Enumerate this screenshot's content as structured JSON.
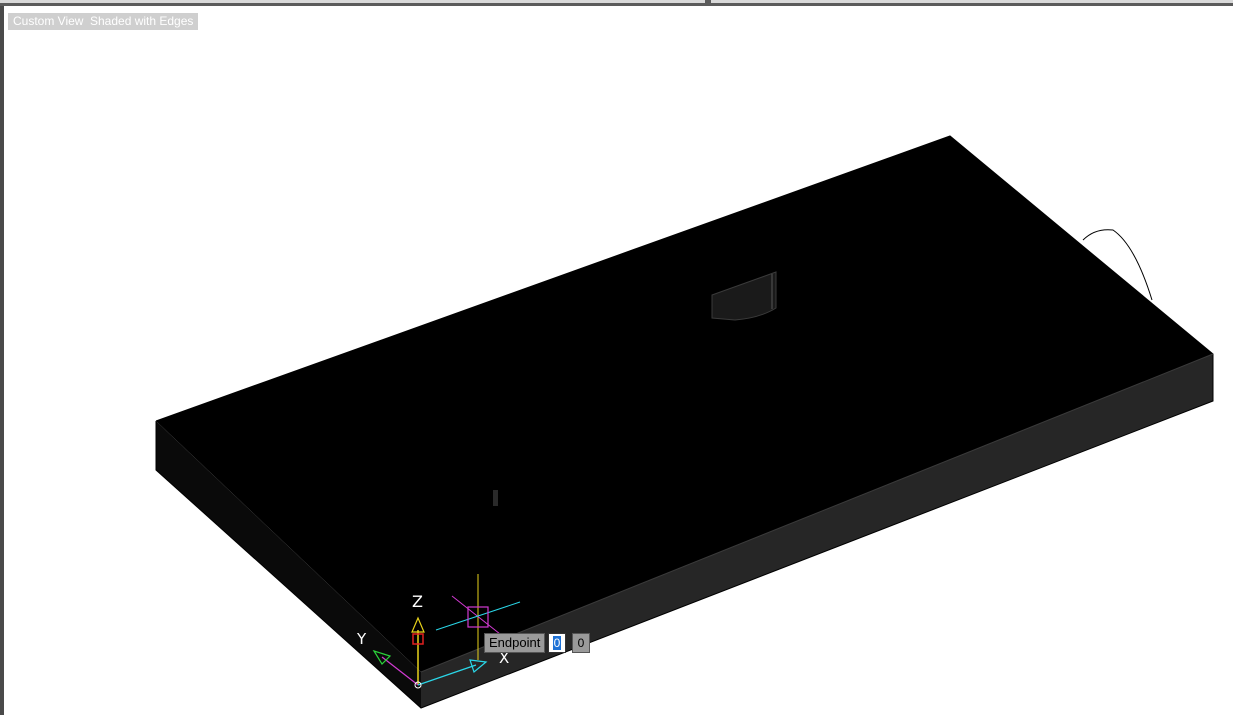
{
  "viewport_controls": {
    "view_label": "Custom View",
    "visual_style_label": "Shaded with Edges"
  },
  "snap_tooltip": {
    "label": "Endpoint",
    "input_x": "0",
    "input_y": "0"
  },
  "ucs": {
    "z_label": "Z",
    "y_label": "Y",
    "x_label": "X"
  },
  "colors": {
    "slab_top": "#000000",
    "slab_front": "#262626",
    "ucs_z": "#e8d21a",
    "ucs_magenta": "#d23ad2",
    "ucs_cyan": "#2ad7e8",
    "ucs_red": "#e02020",
    "ucs_green": "#2bd23a"
  }
}
